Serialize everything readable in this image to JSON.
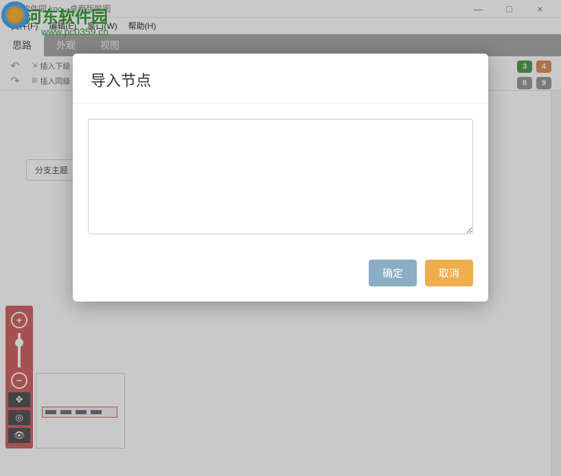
{
  "window": {
    "title": "河东软件园.kno - 桌面版脑图",
    "minimize": "—",
    "maximize": "□",
    "close": "×"
  },
  "watermark": {
    "text": "河东软件园",
    "url": "www.pc0359.cn"
  },
  "menu": {
    "file": "文件(F)",
    "edit": "编辑(E)",
    "window": "窗口(W)",
    "help": "帮助(H)"
  },
  "tabs": {
    "thought": "思路",
    "appearance": "外观",
    "view": "视图"
  },
  "toolbar": {
    "undo": "↶",
    "redo": "↷",
    "insert_below": "插入下级",
    "insert_sibling": "插入同级"
  },
  "priority": {
    "p3": "3",
    "p4": "4",
    "p8": "8",
    "p9": "9"
  },
  "canvas": {
    "branch_topic": "分支主题"
  },
  "zoom": {
    "in": "+",
    "out": "−",
    "move": "✥",
    "target": "◎",
    "eye": "👁"
  },
  "dialog": {
    "title": "导入节点",
    "textarea_value": "",
    "ok": "确定",
    "cancel": "取消"
  }
}
